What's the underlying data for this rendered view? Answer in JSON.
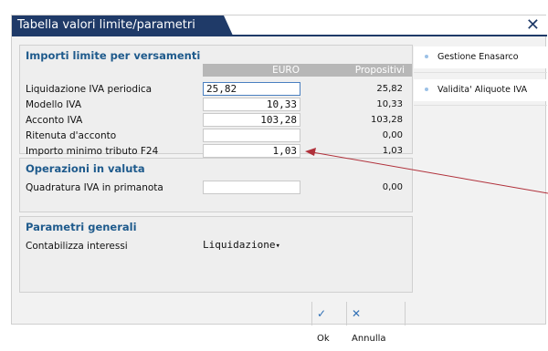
{
  "window": {
    "title": "Tabella valori limite/parametri generali",
    "close_icon": "close-icon"
  },
  "sections": {
    "importi": {
      "title": "Importi limite per versamenti",
      "col_euro": "EURO",
      "col_prop": "Propositivi",
      "rows": [
        {
          "label": "Liquidazione IVA periodica",
          "value": "25,82",
          "prop": "25,82"
        },
        {
          "label": "Modello IVA",
          "value": "10,33",
          "prop": "10,33"
        },
        {
          "label": "Acconto IVA",
          "value": "103,28",
          "prop": "103,28"
        },
        {
          "label": "Ritenuta d'acconto",
          "value": "",
          "prop": "0,00"
        },
        {
          "label": "Importo minimo tributo F24",
          "value": "1,03",
          "prop": "1,03"
        }
      ]
    },
    "valuta": {
      "title": "Operazioni in valuta",
      "rows": [
        {
          "label": "Quadratura IVA in primanota",
          "value": "",
          "prop": "0,00"
        }
      ]
    },
    "parametri": {
      "title": "Parametri generali",
      "rows": [
        {
          "label": "Contabilizza interessi",
          "value": "Liquidazione"
        }
      ]
    }
  },
  "sidebar": {
    "items": [
      {
        "label": "Gestione Enasarco"
      },
      {
        "label": "Validita' Aliquote IVA"
      }
    ]
  },
  "buttons": {
    "ok": "Ok",
    "annulla": "Annulla"
  },
  "colors": {
    "title_bar": "#1f3a68",
    "section_title": "#1e5a8c",
    "header_gray": "#b7b7b7",
    "arrow": "#b0303a"
  }
}
